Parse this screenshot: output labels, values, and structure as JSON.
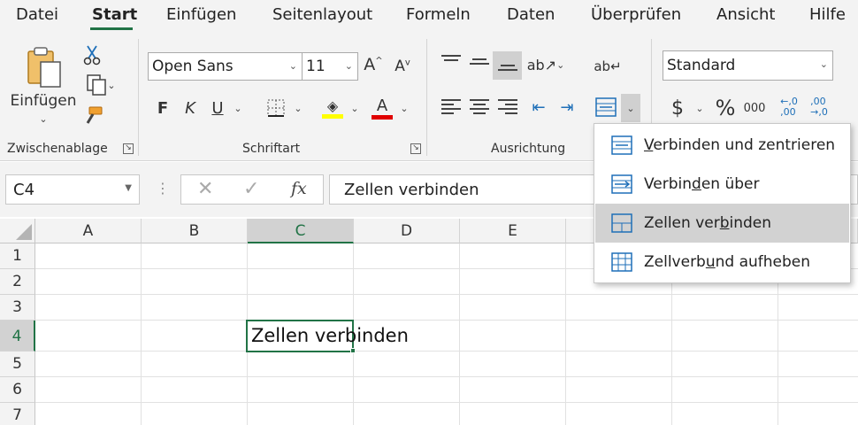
{
  "tabs": [
    "Datei",
    "Start",
    "Einfügen",
    "Seitenlayout",
    "Formeln",
    "Daten",
    "Überprüfen",
    "Ansicht",
    "Hilfe"
  ],
  "active_tab": "Start",
  "clipboard": {
    "paste_label": "Einfügen",
    "group_label": "Zwischenablage"
  },
  "font": {
    "name": "Open Sans",
    "size": "11",
    "group_label": "Schriftart",
    "bold": "F",
    "italic": "K",
    "underline": "U"
  },
  "alignment": {
    "group_label": "Ausrichtung"
  },
  "number": {
    "format": "Standard",
    "currency": "$",
    "percent": "%",
    "thousands": "000"
  },
  "namebox": {
    "value": "C4"
  },
  "formula": {
    "content": "Zellen verbinden",
    "fx": "fx"
  },
  "columns": [
    "A",
    "B",
    "C",
    "D",
    "E"
  ],
  "rows": [
    "1",
    "2",
    "3",
    "4",
    "5",
    "6",
    "7"
  ],
  "selected_column": "C",
  "selected_row": "4",
  "cell_c4": "Zellen verbinden",
  "merge_menu": {
    "items": [
      {
        "label": "Verbinden und zentrieren",
        "mnemonic": "V",
        "highlighted": false
      },
      {
        "label": "Verbinden über",
        "mnemonic": "d",
        "highlighted": false
      },
      {
        "label": "Zellen verbinden",
        "mnemonic": "b",
        "highlighted": true
      },
      {
        "label": "Zellverbund aufheben",
        "mnemonic": "u",
        "highlighted": false
      }
    ]
  },
  "colors": {
    "accent": "#217346",
    "font_color": "#e00000",
    "fill_color": "#ffff00",
    "icon_blue": "#1e6fb8"
  }
}
